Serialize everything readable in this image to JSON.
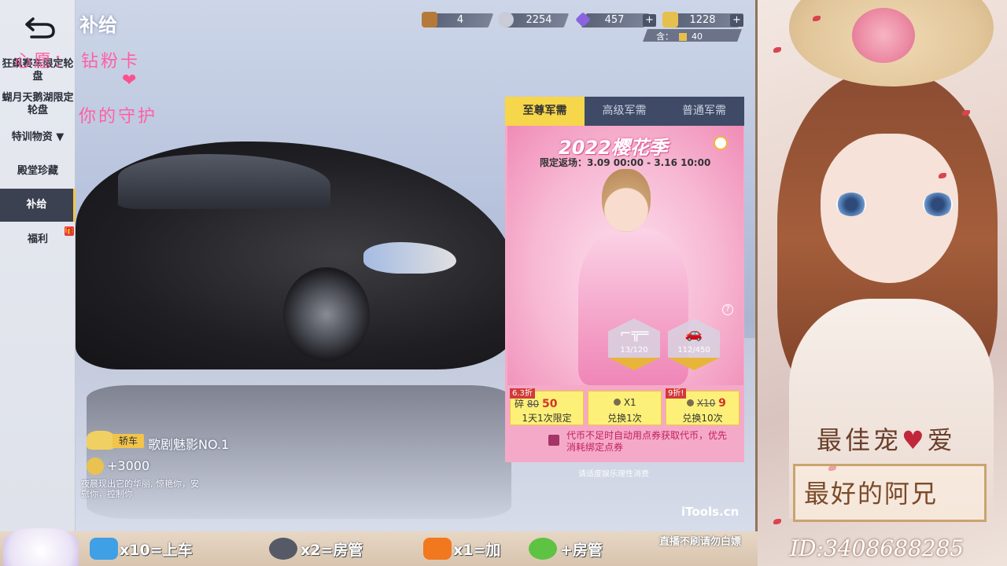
{
  "game": {
    "title": "补给",
    "sidebar": [
      {
        "label": "狂飙赛车限定轮盘",
        "active": false
      },
      {
        "label": "蝴月天鹅湖限定轮盘",
        "active": false
      },
      {
        "label": "特训物资 ▼",
        "active": false
      },
      {
        "label": "殿堂珍藏",
        "active": false
      },
      {
        "label": "补给",
        "active": true
      },
      {
        "label": "福利",
        "active": false
      }
    ],
    "gift_badge": "🎁",
    "wish_text": "心愿： 钻粉卡",
    "wish_heart": "❤",
    "wish_text2": "你的守护",
    "currencies": {
      "crates": "4",
      "coins": "2254",
      "diamonds": "457",
      "vouchers": "1228",
      "voucher_sub": "含：",
      "voucher_sub_value": "40",
      "plus": "+"
    },
    "car": {
      "type_badge": "轿车",
      "name": "歌剧魅影NO.1",
      "reputation": "+3000",
      "description": "夜晨现出它的华丽, 惊艳你，安慰你，控制你"
    },
    "supply_panel": {
      "tabs": [
        "至尊军需",
        "高级军需",
        "普通军需"
      ],
      "season_title": "2022樱花季",
      "time_range": "限定返场：3.09 00:00 - 3.16 10:00",
      "help": "?",
      "badges": [
        {
          "glyph": "⌐╦═",
          "progress": "13/120"
        },
        {
          "glyph": "🚗",
          "progress": "112/450"
        }
      ],
      "buttons": [
        {
          "tag": "6.3折",
          "old_price": "80",
          "new_price": "50",
          "prefix": "碎",
          "bottom": "1天1次限定"
        },
        {
          "tag": "",
          "top": "X1",
          "bottom": "兑换1次"
        },
        {
          "tag": "9折!",
          "old_price": "X10",
          "new_price": "9",
          "prefix": "",
          "bottom": "兑换10次"
        }
      ],
      "auto_note": "代币不足时自动用点券获取代币，优先消耗绑定点券",
      "spend_note": "请适度娱乐理性消费"
    },
    "watermark": "iTools.cn"
  },
  "overlay": {
    "best_love_left": "最佳宠",
    "best_love_heart": "♥",
    "best_love_right": "爱",
    "best_brother": "最好的阿兄",
    "stream_id": "ID:3408688285",
    "bottom": [
      {
        "icon_color": "#3fa0e6",
        "text": "x10=上车"
      },
      {
        "icon_color": "#555a66",
        "text": "x2=房管"
      },
      {
        "icon_color": "#f1781f",
        "text": "x1=加"
      },
      {
        "icon_color": "#5ec243",
        "text": "+房管"
      }
    ],
    "bottom_note": "直播不刷请勿白嫖"
  }
}
